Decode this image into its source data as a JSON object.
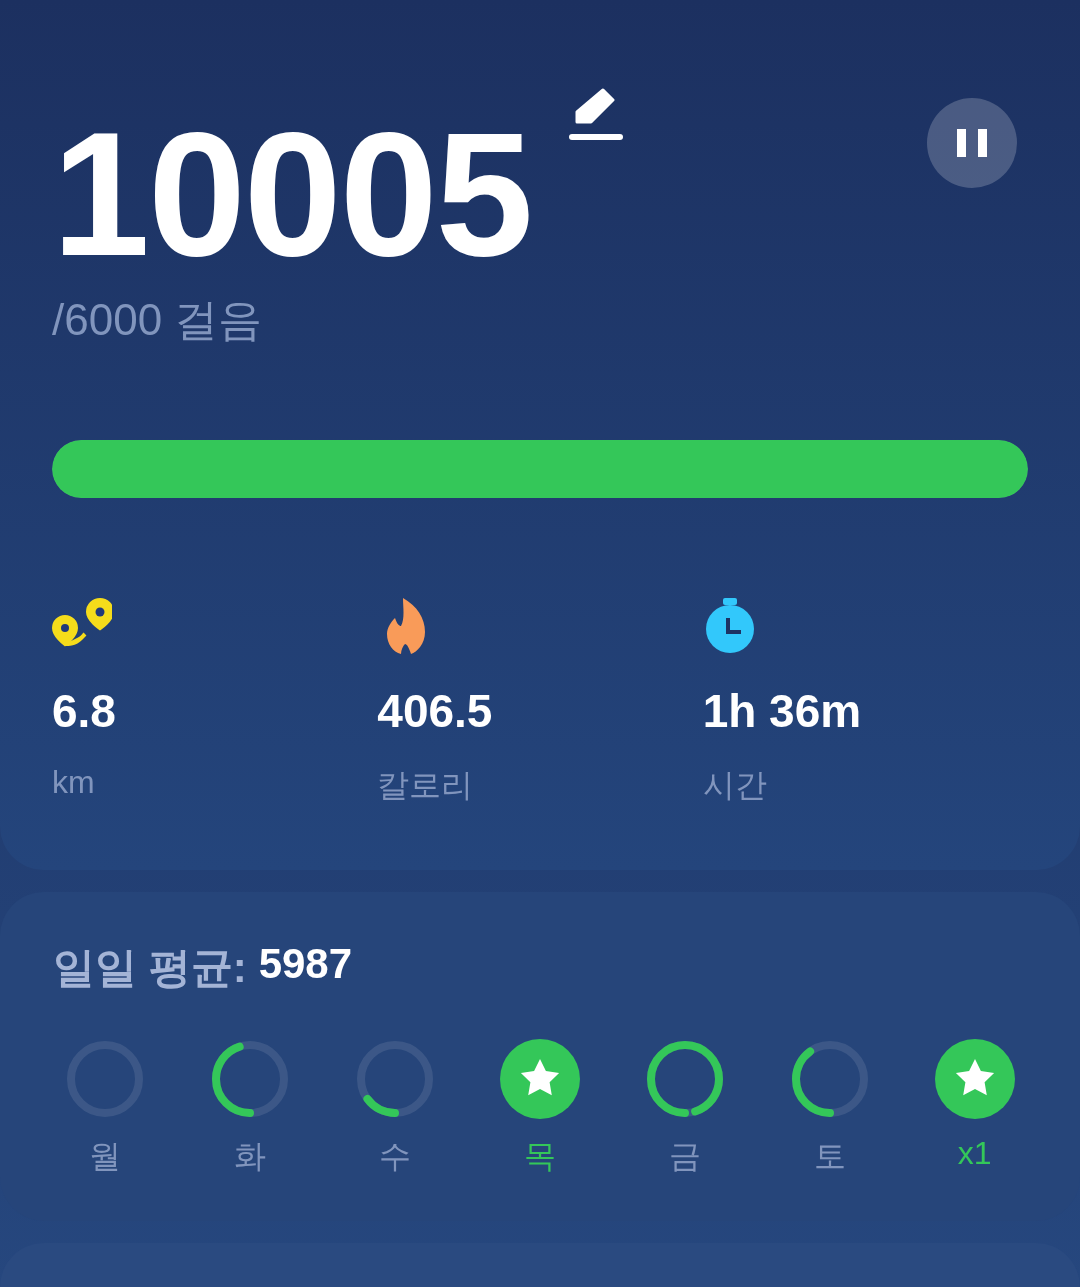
{
  "steps": {
    "count": "10005",
    "goal": "/6000 걸음",
    "level": 1.0
  },
  "stats": [
    {
      "kind": "distance",
      "value": "6.8",
      "label": "km"
    },
    {
      "kind": "calories",
      "value": "406.5",
      "label": "칼로리"
    },
    {
      "kind": "time",
      "value": "1h 36m",
      "label": "시간"
    }
  ],
  "weekly": {
    "label": "일일 평균:",
    "value": "5987",
    "days": [
      {
        "label": "월",
        "completed": false
      },
      {
        "label": "화",
        "completed": false,
        "level": 0.45
      },
      {
        "label": "수",
        "completed": false,
        "level": 0.15
      },
      {
        "label": "목",
        "completed": true
      },
      {
        "label": "금",
        "completed": false,
        "level": 0.95
      },
      {
        "label": "토",
        "completed": false,
        "level": 0.4
      },
      {
        "label": "x1",
        "completed": true
      }
    ]
  }
}
